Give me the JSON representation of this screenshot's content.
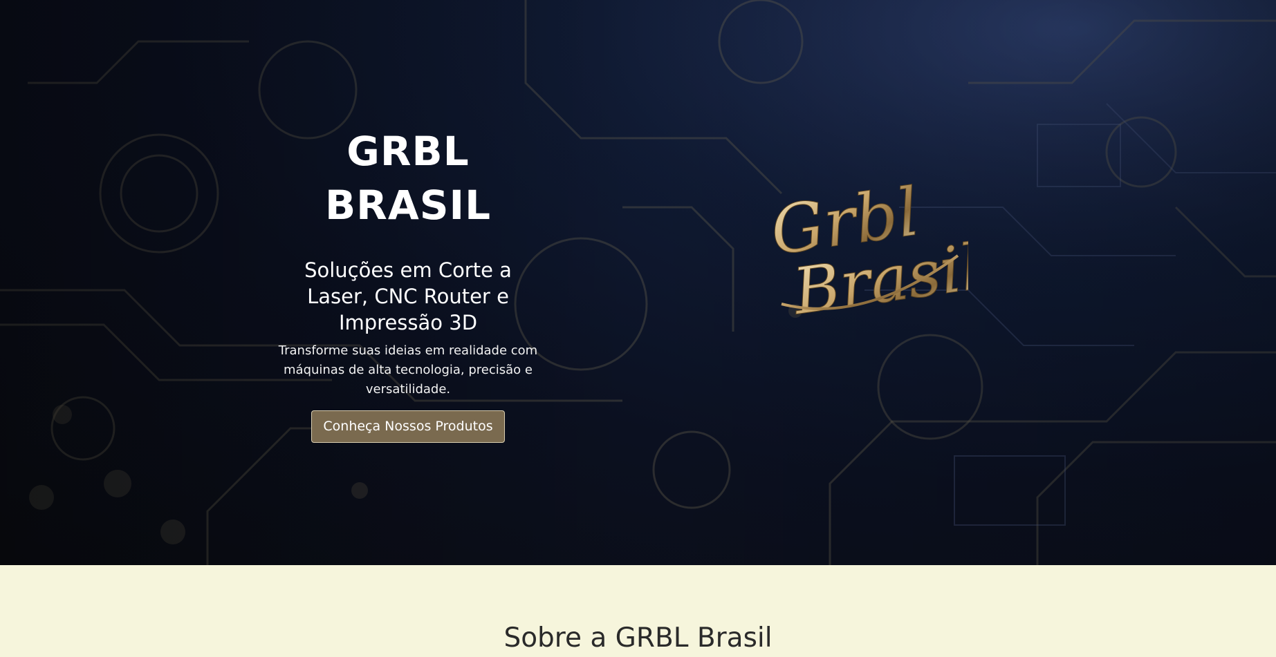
{
  "hero": {
    "title": "GRBL BRASIL",
    "subtitle": "Soluções em Corte a Laser, CNC Router e Impressão 3D",
    "description": "Transforme suas ideias em realidade com máquinas de alta tecnologia, precisão e versatilidade.",
    "cta_label": "Conheça Nossos Produtos",
    "logo_text_line1": "Grbl",
    "logo_text_line2": "Brasil"
  },
  "about": {
    "title": "Sobre a GRBL Brasil"
  },
  "colors": {
    "hero_dark": "#0b1020",
    "accent_gold": "#c9a66b",
    "button_bg": "#7a6a4f",
    "section_bg": "#f6f5dc"
  }
}
